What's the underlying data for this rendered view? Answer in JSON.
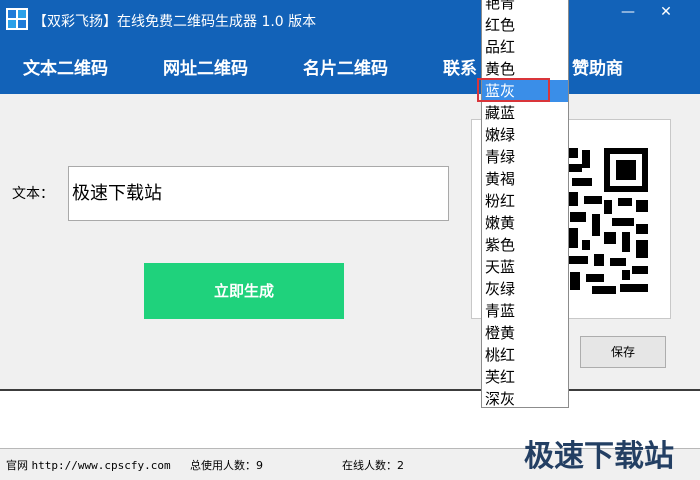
{
  "window": {
    "title": "【双彩飞扬】在线免费二维码生成器 1.0 版本",
    "minimize_glyph": "—",
    "close_glyph": "✕",
    "icon": "app-logo-icon"
  },
  "tabs": [
    "文本二维码",
    "网址二维码",
    "名片二维码",
    "联系",
    "赞助商"
  ],
  "form": {
    "text_label": "文本：",
    "text_value": "极速下载站",
    "generate_label": "立即生成",
    "save_label": "保存"
  },
  "color_dropdown": {
    "items": [
      "艳青",
      "红色",
      "品红",
      "黄色",
      "蓝灰",
      "藏蓝",
      "嫩绿",
      "青绿",
      "黄褐",
      "粉红",
      "嫩黄",
      "紫色",
      "天蓝",
      "灰绿",
      "青蓝",
      "橙黄",
      "桃红",
      "芙红",
      "深灰"
    ],
    "selected": "蓝灰"
  },
  "status_bar": {
    "site_label": "官网",
    "site_url": "http://www.cpscfy.com",
    "total_users": "总使用人数：9",
    "online_users": "在线人数：2"
  },
  "watermark": "极速下载站",
  "colors": {
    "titlebar": "#1262b8",
    "generate_button": "#1fd27c",
    "highlight": "#3a8ee8",
    "selection_outline": "#d9353a"
  }
}
